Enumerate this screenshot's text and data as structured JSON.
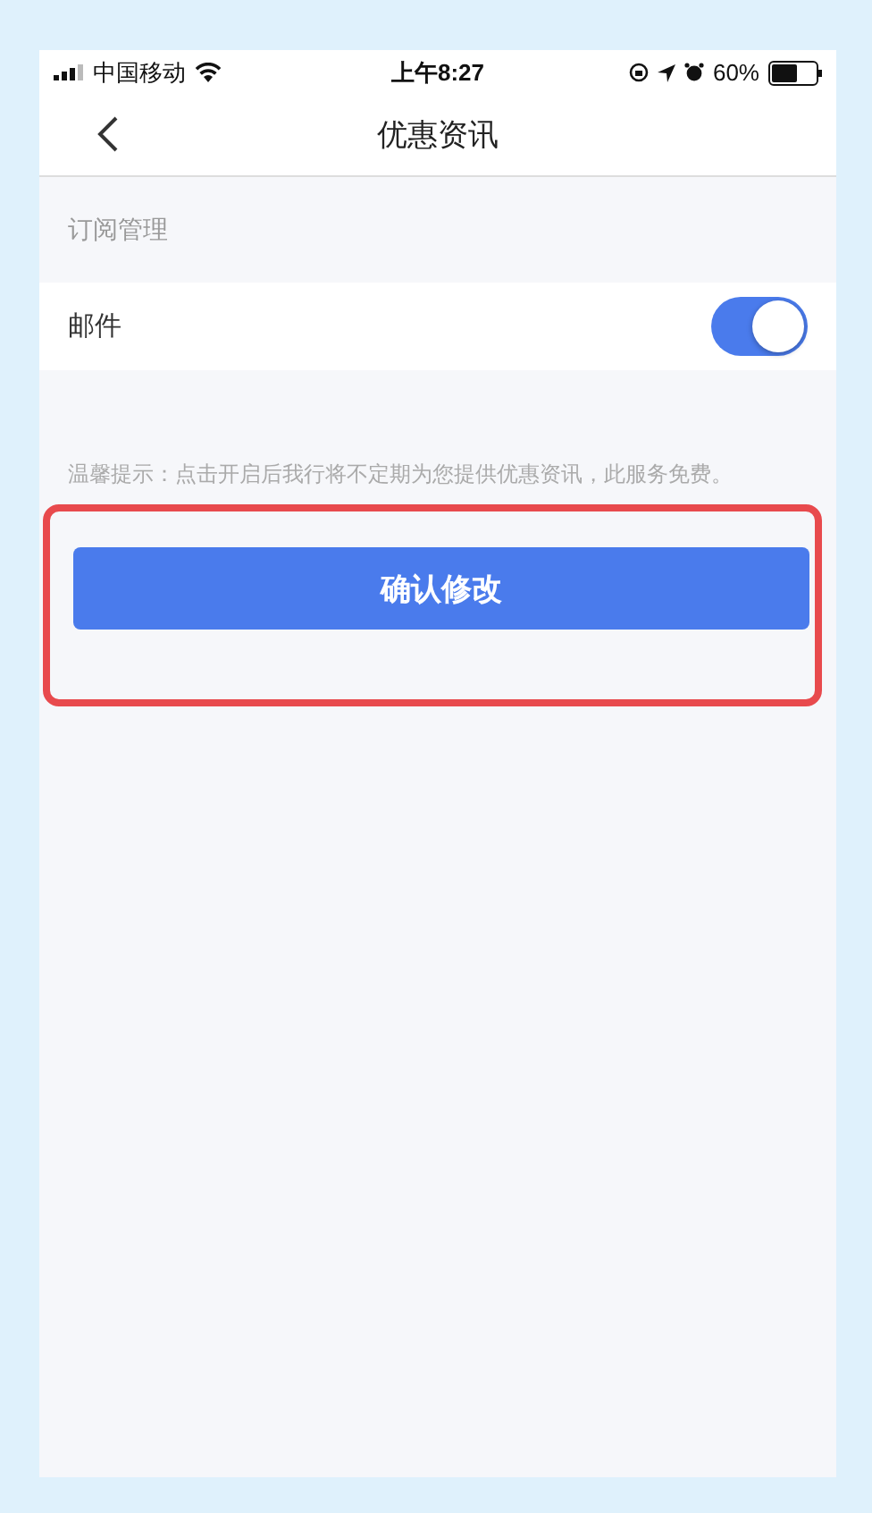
{
  "status_bar": {
    "carrier": "中国移动",
    "time": "上午8:27",
    "battery": "60%"
  },
  "nav": {
    "title": "优惠资讯"
  },
  "section": {
    "title": "订阅管理"
  },
  "settings": [
    {
      "label": "邮件",
      "on": true
    }
  ],
  "tip": "温馨提示：点击开启后我行将不定期为您提供优惠资讯，此服务免费。",
  "confirm_button": "确认修改"
}
